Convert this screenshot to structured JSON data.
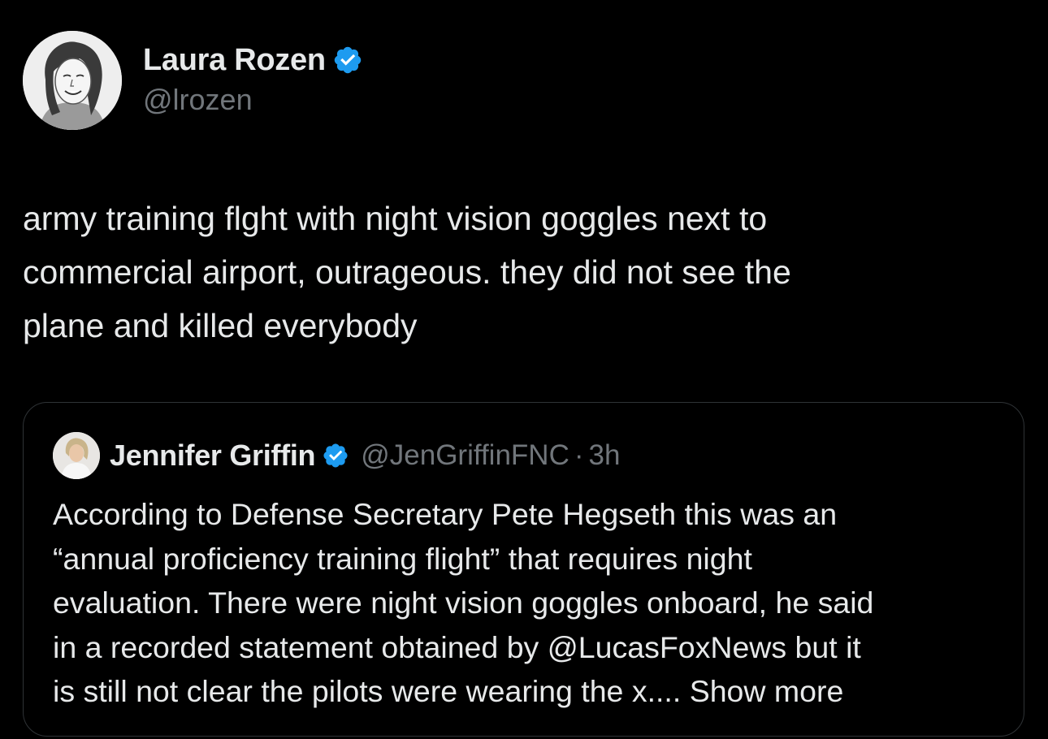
{
  "tweet": {
    "author": {
      "name": "Laura Rozen",
      "handle": "@lrozen",
      "verified_badge_color": "#1d9bf0"
    },
    "text_lines": [
      "army training flght with night vision goggles next to",
      "commercial airport, outrageous. they did not see the",
      "plane and killed everybody"
    ]
  },
  "quoted_tweet": {
    "author": {
      "name": "Jennifer Griffin",
      "handle": "@JenGriffinFNC",
      "separator": "·",
      "time": "3h"
    },
    "text_lines": [
      "According to Defense Secretary Pete Hegseth this was an",
      "“annual proficiency training flight” that requires night",
      "evaluation. There were night vision goggles onboard, he said",
      "in a recorded statement obtained by @LucasFoxNews but it",
      "is still not clear the pilots were wearing the x.... "
    ],
    "show_more_label": "Show more"
  },
  "colors": {
    "background": "#000000",
    "primary_text": "#e7e9ea",
    "secondary_text": "#71767b",
    "border": "#2f3336",
    "verified_blue": "#1d9bf0"
  },
  "icons": {
    "verified": "verified-badge-icon"
  }
}
